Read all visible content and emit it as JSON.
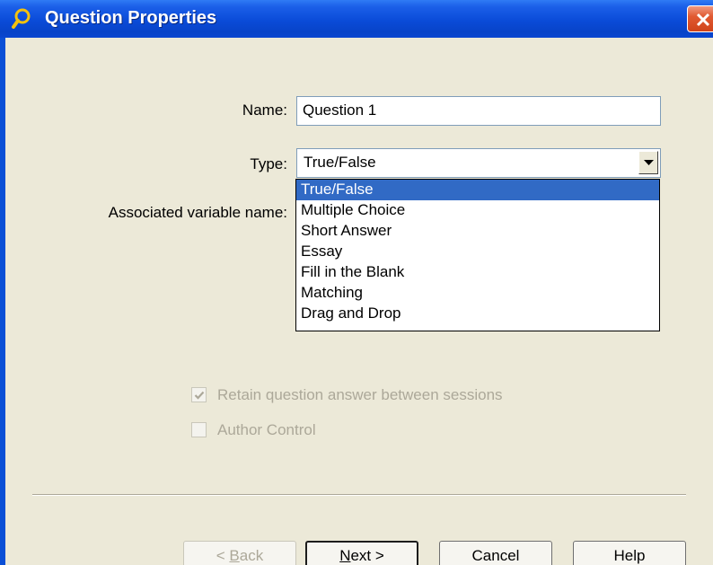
{
  "window": {
    "title": "Question Properties",
    "app_icon": "magnifier-icon",
    "close_icon": "close-icon"
  },
  "form": {
    "name_label": "Name:",
    "name_value": "Question 1",
    "type_label": "Type:",
    "type_value": "True/False",
    "assoc_label": "Associated variable name:"
  },
  "dropdown": {
    "items": [
      "True/False",
      "Multiple Choice",
      "Short Answer",
      "Essay",
      "Fill in the Blank",
      "Matching",
      "Drag and Drop"
    ],
    "selected": "True/False"
  },
  "options": {
    "retain_label": "Retain question answer between sessions",
    "retain_checked": true,
    "author_label": "Author Control",
    "author_checked": false
  },
  "buttons": {
    "back_prefix": "< ",
    "back_mnemonic": "B",
    "back_rest": "ack",
    "next_mnemonic": "N",
    "next_rest": "ext >",
    "cancel": "Cancel",
    "help": "Help"
  },
  "colors": {
    "title_bar": "#0A4BD8",
    "selection": "#316AC5",
    "dialog_face": "#ECE9D8",
    "close_button": "#E15A32"
  }
}
